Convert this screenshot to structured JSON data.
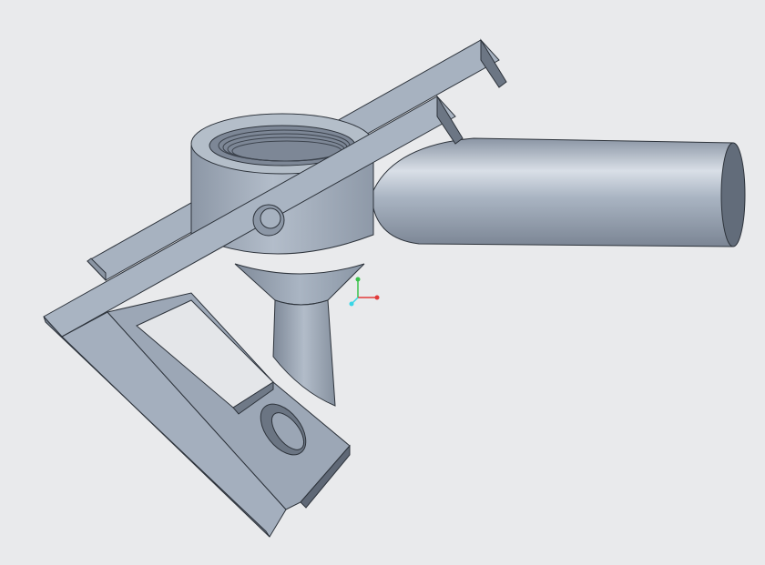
{
  "viewport": {
    "background": "#e9eaec",
    "model": {
      "parts": [
        {
          "name": "back-bracket-bar"
        },
        {
          "name": "threaded-cylinder"
        },
        {
          "name": "side-tube"
        },
        {
          "name": "funnel"
        },
        {
          "name": "spout"
        },
        {
          "name": "front-bracket-frame"
        },
        {
          "name": "slotted-plate"
        },
        {
          "name": "pivot-pin"
        }
      ],
      "colors": {
        "face_light": "#a9b4c2",
        "face_mid": "#8f9aa9",
        "face_dark": "#6c7684",
        "edge": "#2d333b",
        "highlight": "#e2e7ee"
      }
    },
    "triad": {
      "icon": "coordinate-triad-icon",
      "x_axis_color": "#e23a3a",
      "y_axis_color": "#38c24a",
      "z_axis_color": "#39d6e6"
    }
  }
}
